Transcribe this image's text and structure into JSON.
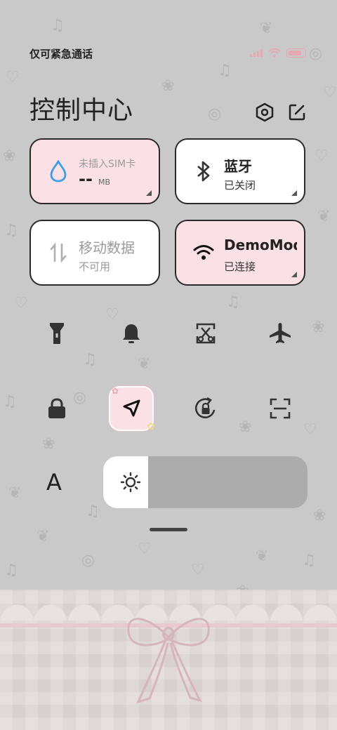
{
  "status_bar": {
    "carrier_text": "仅可紧急通话"
  },
  "header": {
    "title": "控制中心",
    "settings_icon": "settings-hex-icon",
    "edit_icon": "edit-icon"
  },
  "tiles": {
    "data_usage": {
      "title": "未插入SIM卡",
      "value": "--",
      "unit": "MB",
      "icon": "water-drop-icon"
    },
    "bluetooth": {
      "title": "蓝牙",
      "status": "已关闭",
      "icon": "bluetooth-icon"
    },
    "mobile_data": {
      "title": "移动数据",
      "status": "不可用",
      "icon": "data-arrows-icon"
    },
    "wifi": {
      "title": "DemoMode",
      "status": "已连接",
      "icon": "wifi-icon"
    }
  },
  "toggles_row1": [
    "flashlight-icon",
    "bell-icon",
    "screenshot-icon",
    "airplane-icon"
  ],
  "toggles_row2": [
    "lock-icon",
    "location-icon",
    "rotation-lock-icon",
    "scan-icon"
  ],
  "brightness": {
    "level": 0.22,
    "icon": "sun-icon"
  },
  "font_label": "A",
  "colors": {
    "tile_pink": "#fbe1e6",
    "background": "#c9c9c9",
    "accent_blue": "#3aa0e8"
  }
}
